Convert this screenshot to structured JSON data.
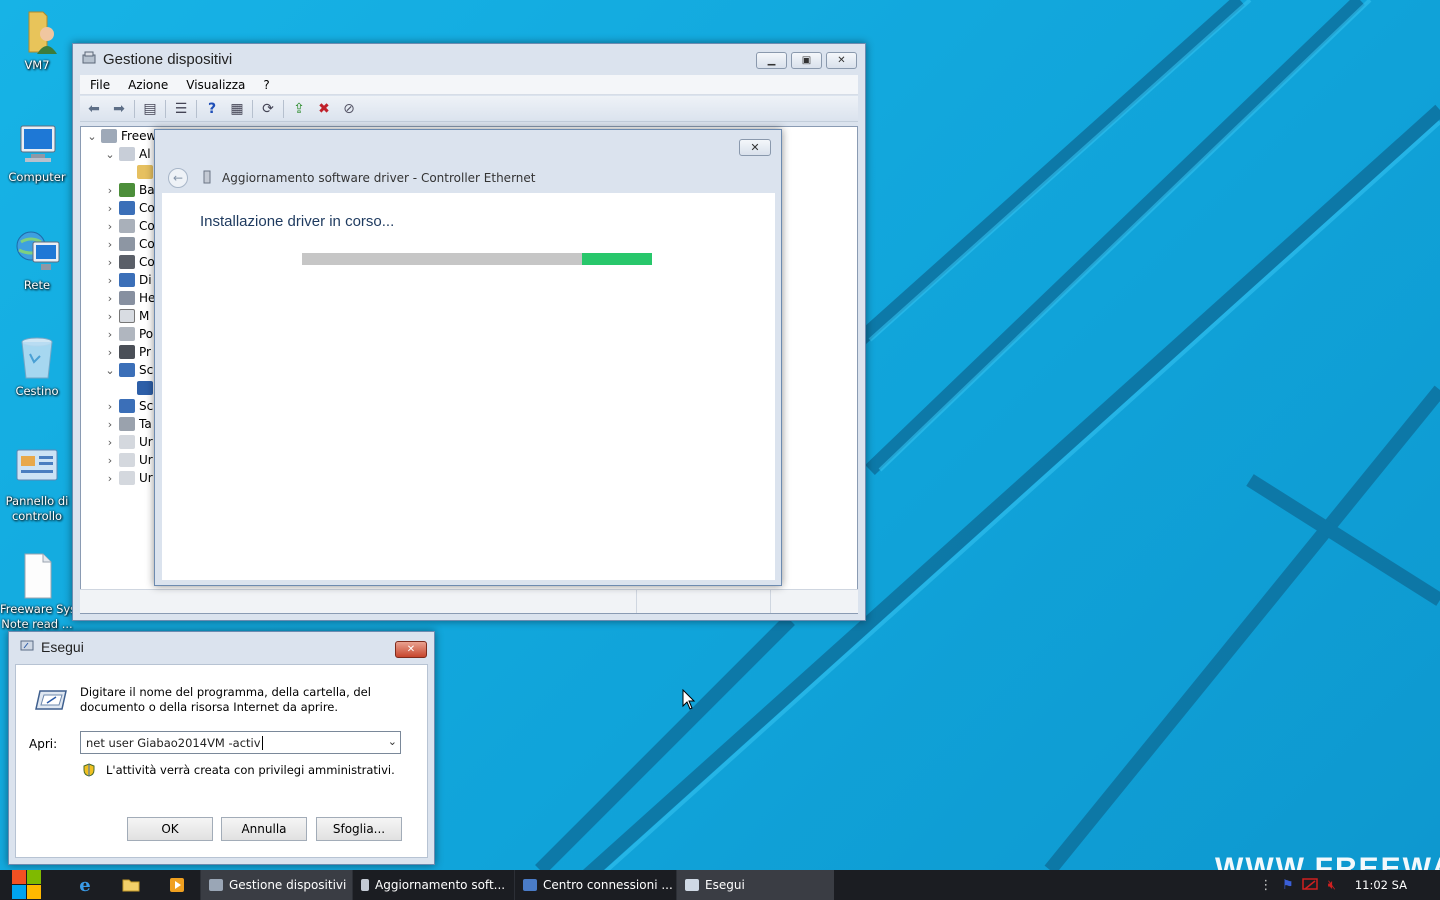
{
  "desktop": {
    "icons": [
      {
        "label": "VM7"
      },
      {
        "label": "Computer"
      },
      {
        "label": "Rete"
      },
      {
        "label": "Cestino"
      },
      {
        "label_line1": "Pannello di",
        "label_line2": "controllo"
      },
      {
        "label_line1": "Freeware Sys",
        "label_line2": "Note read ..."
      }
    ],
    "watermark": "WWW.FREEWARESY"
  },
  "device_manager": {
    "title": "Gestione dispositivi",
    "menu": [
      "File",
      "Azione",
      "Visualizza",
      "?"
    ],
    "tree": [
      {
        "text": "Freew",
        "expanded": true
      },
      {
        "text": "Al",
        "expanded": true
      },
      {
        "text": ""
      },
      {
        "text": "Ba"
      },
      {
        "text": "Co"
      },
      {
        "text": "Co"
      },
      {
        "text": "Co"
      },
      {
        "text": "Co"
      },
      {
        "text": "Di"
      },
      {
        "text": "He"
      },
      {
        "text": "M"
      },
      {
        "text": "Po"
      },
      {
        "text": "Pr"
      },
      {
        "text": "Sc",
        "expanded": true
      },
      {
        "text": ""
      },
      {
        "text": "Sc"
      },
      {
        "text": "Ta"
      },
      {
        "text": "Ur"
      },
      {
        "text": "Ur"
      },
      {
        "text": "Ur"
      }
    ]
  },
  "driver_dialog": {
    "title": "Aggiornamento software driver - Controller Ethernet",
    "status": "Installazione driver in corso...",
    "progress_fraction": 0.2,
    "progress_offset_fraction": 0.8,
    "close_label": "✕"
  },
  "run_dialog": {
    "title": "Esegui",
    "description": "Digitare il nome del programma, della cartella, del documento o della risorsa Internet da aprire.",
    "open_label": "Apri:",
    "input_value": "net user Giabao2014VM -activ",
    "admin_note": "L'attività verrà creata con privilegi amministrativi.",
    "ok_label": "OK",
    "cancel_label": "Annulla",
    "browse_label": "Sfoglia..."
  },
  "taskbar": {
    "tasks": [
      {
        "label": "Gestione dispositivi"
      },
      {
        "label": "Aggiornamento soft..."
      },
      {
        "label": "Centro connessioni ..."
      },
      {
        "label": "Esegui"
      }
    ],
    "clock": "11:02 SA"
  },
  "colors": {
    "desktop": "#10a3d9",
    "progress_fill": "#28c76b",
    "taskbar": "#1b1d22"
  }
}
